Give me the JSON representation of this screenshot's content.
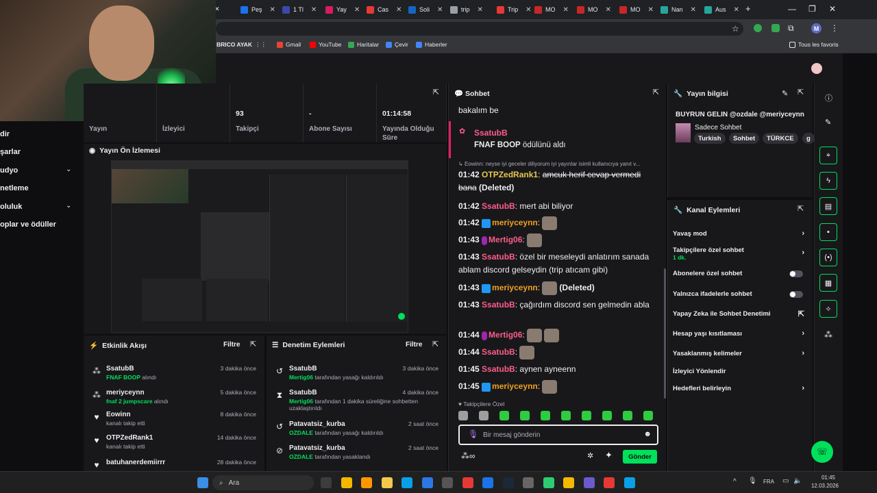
{
  "browser": {
    "tabs": [
      {
        "label": "Peş",
        "color": "#1a73e8"
      },
      {
        "label": "1 Tl",
        "color": "#3949ab"
      },
      {
        "label": "Yay",
        "color": "#d81b60"
      },
      {
        "label": "Cas",
        "color": "#e53935"
      },
      {
        "label": "Soli",
        "color": "#1565c0"
      },
      {
        "label": "trip",
        "color": "#9aa0a6"
      },
      {
        "label": "Trip",
        "color": "#e53935"
      },
      {
        "label": "MO",
        "color": "#c62828"
      },
      {
        "label": "MO",
        "color": "#c62828"
      },
      {
        "label": "MO",
        "color": "#c62828"
      },
      {
        "label": "Nan",
        "color": "#26a69a"
      },
      {
        "label": "Aus",
        "color": "#26a69a"
      }
    ],
    "bookmarks": [
      "BRICO AYAK",
      "Gmail",
      "YouTube",
      "Haritalar",
      "Çevir",
      "Haberler"
    ],
    "all_bookmarks": "Tous les favoris",
    "profile_initial": "M"
  },
  "left_nav": [
    {
      "label": "dir",
      "chevron": false
    },
    {
      "label": "şarlar",
      "chevron": false
    },
    {
      "label": "udyo",
      "chevron": true
    },
    {
      "label": "netleme",
      "chevron": false
    },
    {
      "label": "oluluk",
      "chevron": true
    },
    {
      "label": "oplar ve ödüller",
      "chevron": false
    }
  ],
  "stats": [
    {
      "value": "",
      "label": "Yayın"
    },
    {
      "value": "",
      "label": "İzleyici"
    },
    {
      "value": "93",
      "label": "Takipçi"
    },
    {
      "value": "-",
      "label": "Abone Sayısı"
    },
    {
      "value": "01:14:58",
      "label": "Yayında Olduğu Süre"
    }
  ],
  "preview": {
    "title": "Yayın Ön İzlemesi"
  },
  "activity": {
    "title": "Etkinlik Akışı",
    "filter": "Filtre",
    "items": [
      {
        "icon": "points",
        "name": "SsatubB",
        "highlight": "FNAF BOOP",
        "detail": " alındı",
        "time": "3 dakika önce"
      },
      {
        "icon": "points",
        "name": "meriyceynn",
        "highlight": "fnaf 2 jumpscare",
        "detail": " alındı",
        "time": "5 dakika önce"
      },
      {
        "icon": "heart",
        "name": "Eowinn",
        "highlight": "",
        "detail": "kanalı takip etti",
        "time": "8 dakika önce"
      },
      {
        "icon": "heart",
        "name": "OTPZedRank1",
        "highlight": "",
        "detail": "kanalı takip etti",
        "time": "14 dakika önce"
      },
      {
        "icon": "heart",
        "name": "batuhanerdemiirrr",
        "highlight": "",
        "detail": "",
        "time": "28 dakika önce"
      }
    ]
  },
  "moderation": {
    "title": "Denetim Eylemleri",
    "filter": "Filtre",
    "items": [
      {
        "icon": "undo",
        "name": "SsatubB",
        "highlight": "Mertig06",
        "detail": " tarafından yasağı kaldırıldı",
        "time": "3 dakika önce"
      },
      {
        "icon": "timeout",
        "name": "SsatubB",
        "highlight": "Mertig06",
        "detail": " tarafından 1 dakika süreliğine sohbetten uzaklaştırıldı",
        "time": "4 dakika önce"
      },
      {
        "icon": "undo",
        "name": "Patavatsiz_kurba",
        "highlight": "OZDALE",
        "detail": " tarafından yasağı kaldırıldı",
        "time": "2 saat önce"
      },
      {
        "icon": "ban",
        "name": "Patavatsiz_kurba",
        "highlight": "OZDALE",
        "detail": " tarafından yasaklandı",
        "time": "2 saat önce"
      }
    ]
  },
  "chat": {
    "title": "Sohbet",
    "top_text": "bakalım be",
    "redeem_user": "SsatubB",
    "redeem_reward": "FNAF BOOP",
    "redeem_suffix": " ödülünü aldı",
    "reply_context": "Eowinn: neyse iyi geceler diliyorum iyi yayınlar isimli kullanıcıya yanıt v...",
    "messages": [
      {
        "time": "01:42",
        "user": "OTPZedRank1",
        "color": "#e8c84a",
        "badge": "",
        "text": "amcuk herif cevap vermedi bana",
        "deleted": true,
        "emotes": 0
      },
      {
        "time": "01:42",
        "user": "SsatubB",
        "color": "#ff5c8a",
        "badge": "",
        "text": "mert abi biliyor",
        "deleted": false,
        "emotes": 0
      },
      {
        "time": "01:42",
        "user": "meriyceynn",
        "color": "#f0a020",
        "badge": "sword",
        "text": "",
        "deleted": false,
        "emotes": 1
      },
      {
        "time": "01:43",
        "user": "Mertig06",
        "color": "#ff5c8a",
        "badge": "mic",
        "text": "",
        "deleted": false,
        "emotes": 1
      },
      {
        "time": "01:43",
        "user": "SsatubB",
        "color": "#ff5c8a",
        "badge": "",
        "text": "özel bir meseleydi anlatırım sanada ablam discord gelseydin (trip atıcam gibi)",
        "deleted": false,
        "emotes": 0
      },
      {
        "time": "01:43",
        "user": "meriyceynn",
        "color": "#f0a020",
        "badge": "sword",
        "text": "(Deleted)",
        "deleted": false,
        "emotes": 1
      },
      {
        "time": "01:43",
        "user": "SsatubB",
        "color": "#ff5c8a",
        "badge": "",
        "text": "çağırdım discord sen gelmedin abla",
        "deleted": false,
        "emotes": 0
      },
      {
        "time": "01:44",
        "user": "Mertig06",
        "color": "#ff5c8a",
        "badge": "mic",
        "text": "",
        "deleted": false,
        "emotes": 2
      },
      {
        "time": "01:44",
        "user": "SsatubB",
        "color": "#ff5c8a",
        "badge": "",
        "text": "",
        "deleted": false,
        "emotes": 1
      },
      {
        "time": "01:45",
        "user": "SsatubB",
        "color": "#ff5c8a",
        "badge": "",
        "text": "aynen ayneenn",
        "deleted": false,
        "emotes": 0
      },
      {
        "time": "01:45",
        "user": "meriyceynn",
        "color": "#f0a020",
        "badge": "sword",
        "text": "",
        "deleted": false,
        "emotes": 1
      }
    ],
    "deleted_label": "(Deleted)",
    "followers_only": "Takipçilere Özel",
    "input_placeholder": "Bir mesaj gönderin",
    "send": "Gönder"
  },
  "stream_info": {
    "title": "Yayın bilgisi",
    "stream_title": "BUYRUN GELIN @ozdale @meriyceynn",
    "category": "Sadece Sohbet",
    "tags": [
      "Turkish",
      "Sohbet",
      "TÜRKCE",
      "g"
    ]
  },
  "channel_actions": {
    "title": "Kanal Eylemleri",
    "items": [
      {
        "label": "Yavaş mod",
        "sub": "",
        "control": "chevron"
      },
      {
        "label": "Takipçilere özel sohbet",
        "sub": "1 dk.",
        "control": "chevron"
      },
      {
        "label": "Abonelere özel sohbet",
        "sub": "",
        "control": "toggle"
      },
      {
        "label": "Yalnızca ifadelerle sohbet",
        "sub": "",
        "control": "toggle"
      },
      {
        "label": "Yapay Zeka ile Sohbet Denetimi",
        "sub": "",
        "control": "external"
      },
      {
        "label": "Hesap yaşı kısıtlaması",
        "sub": "",
        "control": "chevron"
      },
      {
        "label": "Yasaklanmış kelimeler",
        "sub": "",
        "control": "chevron"
      },
      {
        "label": "İzleyici Yönlendir",
        "sub": "",
        "control": "none"
      },
      {
        "label": "Hedefleri belirleyin",
        "sub": "",
        "control": "chevron"
      }
    ]
  },
  "taskbar": {
    "search": "Ara",
    "lang": "FRA",
    "time": "01:45",
    "date": "12.03.2026"
  },
  "colors": {
    "accent": "#00e05a",
    "redeem": "#e91e63",
    "bg": "#0e0e10",
    "panel": "#18181b"
  }
}
